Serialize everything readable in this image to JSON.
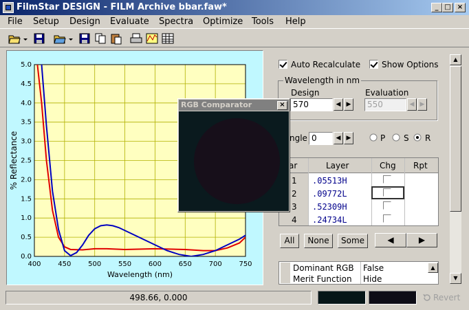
{
  "window": {
    "title": "FilmStar DESIGN - FILM Archive bbar.faw*",
    "min": "_",
    "max": "□",
    "close": "×"
  },
  "menu": [
    "File",
    "Setup",
    "Design",
    "Evaluate",
    "Spectra",
    "Optimize",
    "Tools",
    "Help"
  ],
  "chart_data": {
    "type": "line",
    "xlabel": "Wavelength (nm)",
    "ylabel": "% Reflectance",
    "xlim": [
      400,
      750
    ],
    "ylim": [
      0,
      5
    ],
    "xticks": [
      "400",
      "450",
      "500",
      "550",
      "600",
      "650",
      "700",
      "750"
    ],
    "yticks": [
      "0.0",
      "0.5",
      "1.0",
      "1.5",
      "2.0",
      "2.5",
      "3.0",
      "3.5",
      "4.0",
      "4.5",
      "5.0"
    ],
    "grid": true,
    "series": [
      {
        "color": "#e00000",
        "x": [
          405,
          412,
          420,
          430,
          440,
          450,
          460,
          480,
          500,
          520,
          550,
          600,
          650,
          680,
          700,
          720,
          740,
          750
        ],
        "y": [
          5.0,
          4.0,
          2.5,
          1.2,
          0.5,
          0.25,
          0.18,
          0.17,
          0.2,
          0.2,
          0.18,
          0.2,
          0.18,
          0.15,
          0.15,
          0.22,
          0.35,
          0.5
        ]
      },
      {
        "color": "#0000c0",
        "x": [
          412,
          420,
          430,
          440,
          450,
          460,
          470,
          480,
          490,
          500,
          510,
          520,
          530,
          540,
          560,
          580,
          600,
          620,
          640,
          660,
          680,
          700,
          720,
          740,
          750
        ],
        "y": [
          5.0,
          3.4,
          1.7,
          0.7,
          0.15,
          0.02,
          0.1,
          0.3,
          0.55,
          0.72,
          0.8,
          0.82,
          0.8,
          0.75,
          0.6,
          0.45,
          0.3,
          0.15,
          0.05,
          0.0,
          0.05,
          0.15,
          0.3,
          0.45,
          0.55
        ]
      }
    ]
  },
  "opts": {
    "auto_recalc": "Auto Recalculate",
    "show_options": "Show Options"
  },
  "wavelength": {
    "group": "Wavelength in nm",
    "design_label": "Design",
    "design_value": "570",
    "eval_label": "Evaluation",
    "eval_value": "550"
  },
  "angle": {
    "label": "ngle",
    "value": "0"
  },
  "pol": {
    "p": "P",
    "s": "S",
    "r": "R",
    "selected": "R"
  },
  "grid": {
    "headers": [
      "ar",
      "Layer",
      "Chg",
      "Rpt"
    ],
    "rows": [
      {
        "n": "1",
        "layer": ".05513H"
      },
      {
        "n": "2",
        "layer": ".09772L"
      },
      {
        "n": "3",
        "layer": ".52309H"
      },
      {
        "n": "4",
        "layer": ".24734L"
      }
    ]
  },
  "buttons": {
    "all": "All",
    "none": "None",
    "some": "Some",
    "prev": "◀",
    "next": "▶"
  },
  "props": [
    {
      "k": "Dominant RGB",
      "v": "False"
    },
    {
      "k": "Merit Function",
      "v": "Hide"
    }
  ],
  "rgb": {
    "title": "RGB Comparator",
    "close": "×",
    "bg": "#0a1a1e",
    "circle": "#170f1a"
  },
  "status": {
    "coords": "498.66, 0.000",
    "revert": "Revert",
    "swatch1": "#061618",
    "swatch2": "#0d0c16"
  }
}
